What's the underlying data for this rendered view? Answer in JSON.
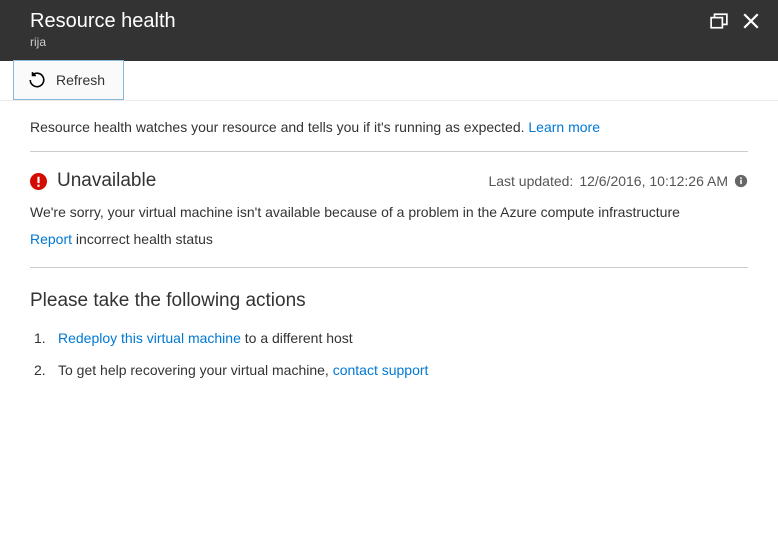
{
  "header": {
    "title": "Resource health",
    "subtitle": "rija"
  },
  "toolbar": {
    "refresh_label": "Refresh"
  },
  "intro": {
    "text": "Resource health watches your resource and tells you if it's running as expected. ",
    "learn_more": "Learn more"
  },
  "status": {
    "title": "Unavailable",
    "last_updated_label": "Last updated: ",
    "last_updated_value": "12/6/2016, 10:12:26 AM",
    "message": "We're sorry, your virtual machine isn't available because of a problem in the Azure compute infrastructure",
    "report_link": "Report",
    "report_suffix": " incorrect health status"
  },
  "actions": {
    "heading": "Please take the following actions",
    "items": [
      {
        "num": "1.",
        "link": "Redeploy this virtual machine",
        "suffix": " to a different host"
      },
      {
        "num": "2.",
        "prefix": "To get help recovering your virtual machine, ",
        "link": "contact support"
      }
    ]
  }
}
